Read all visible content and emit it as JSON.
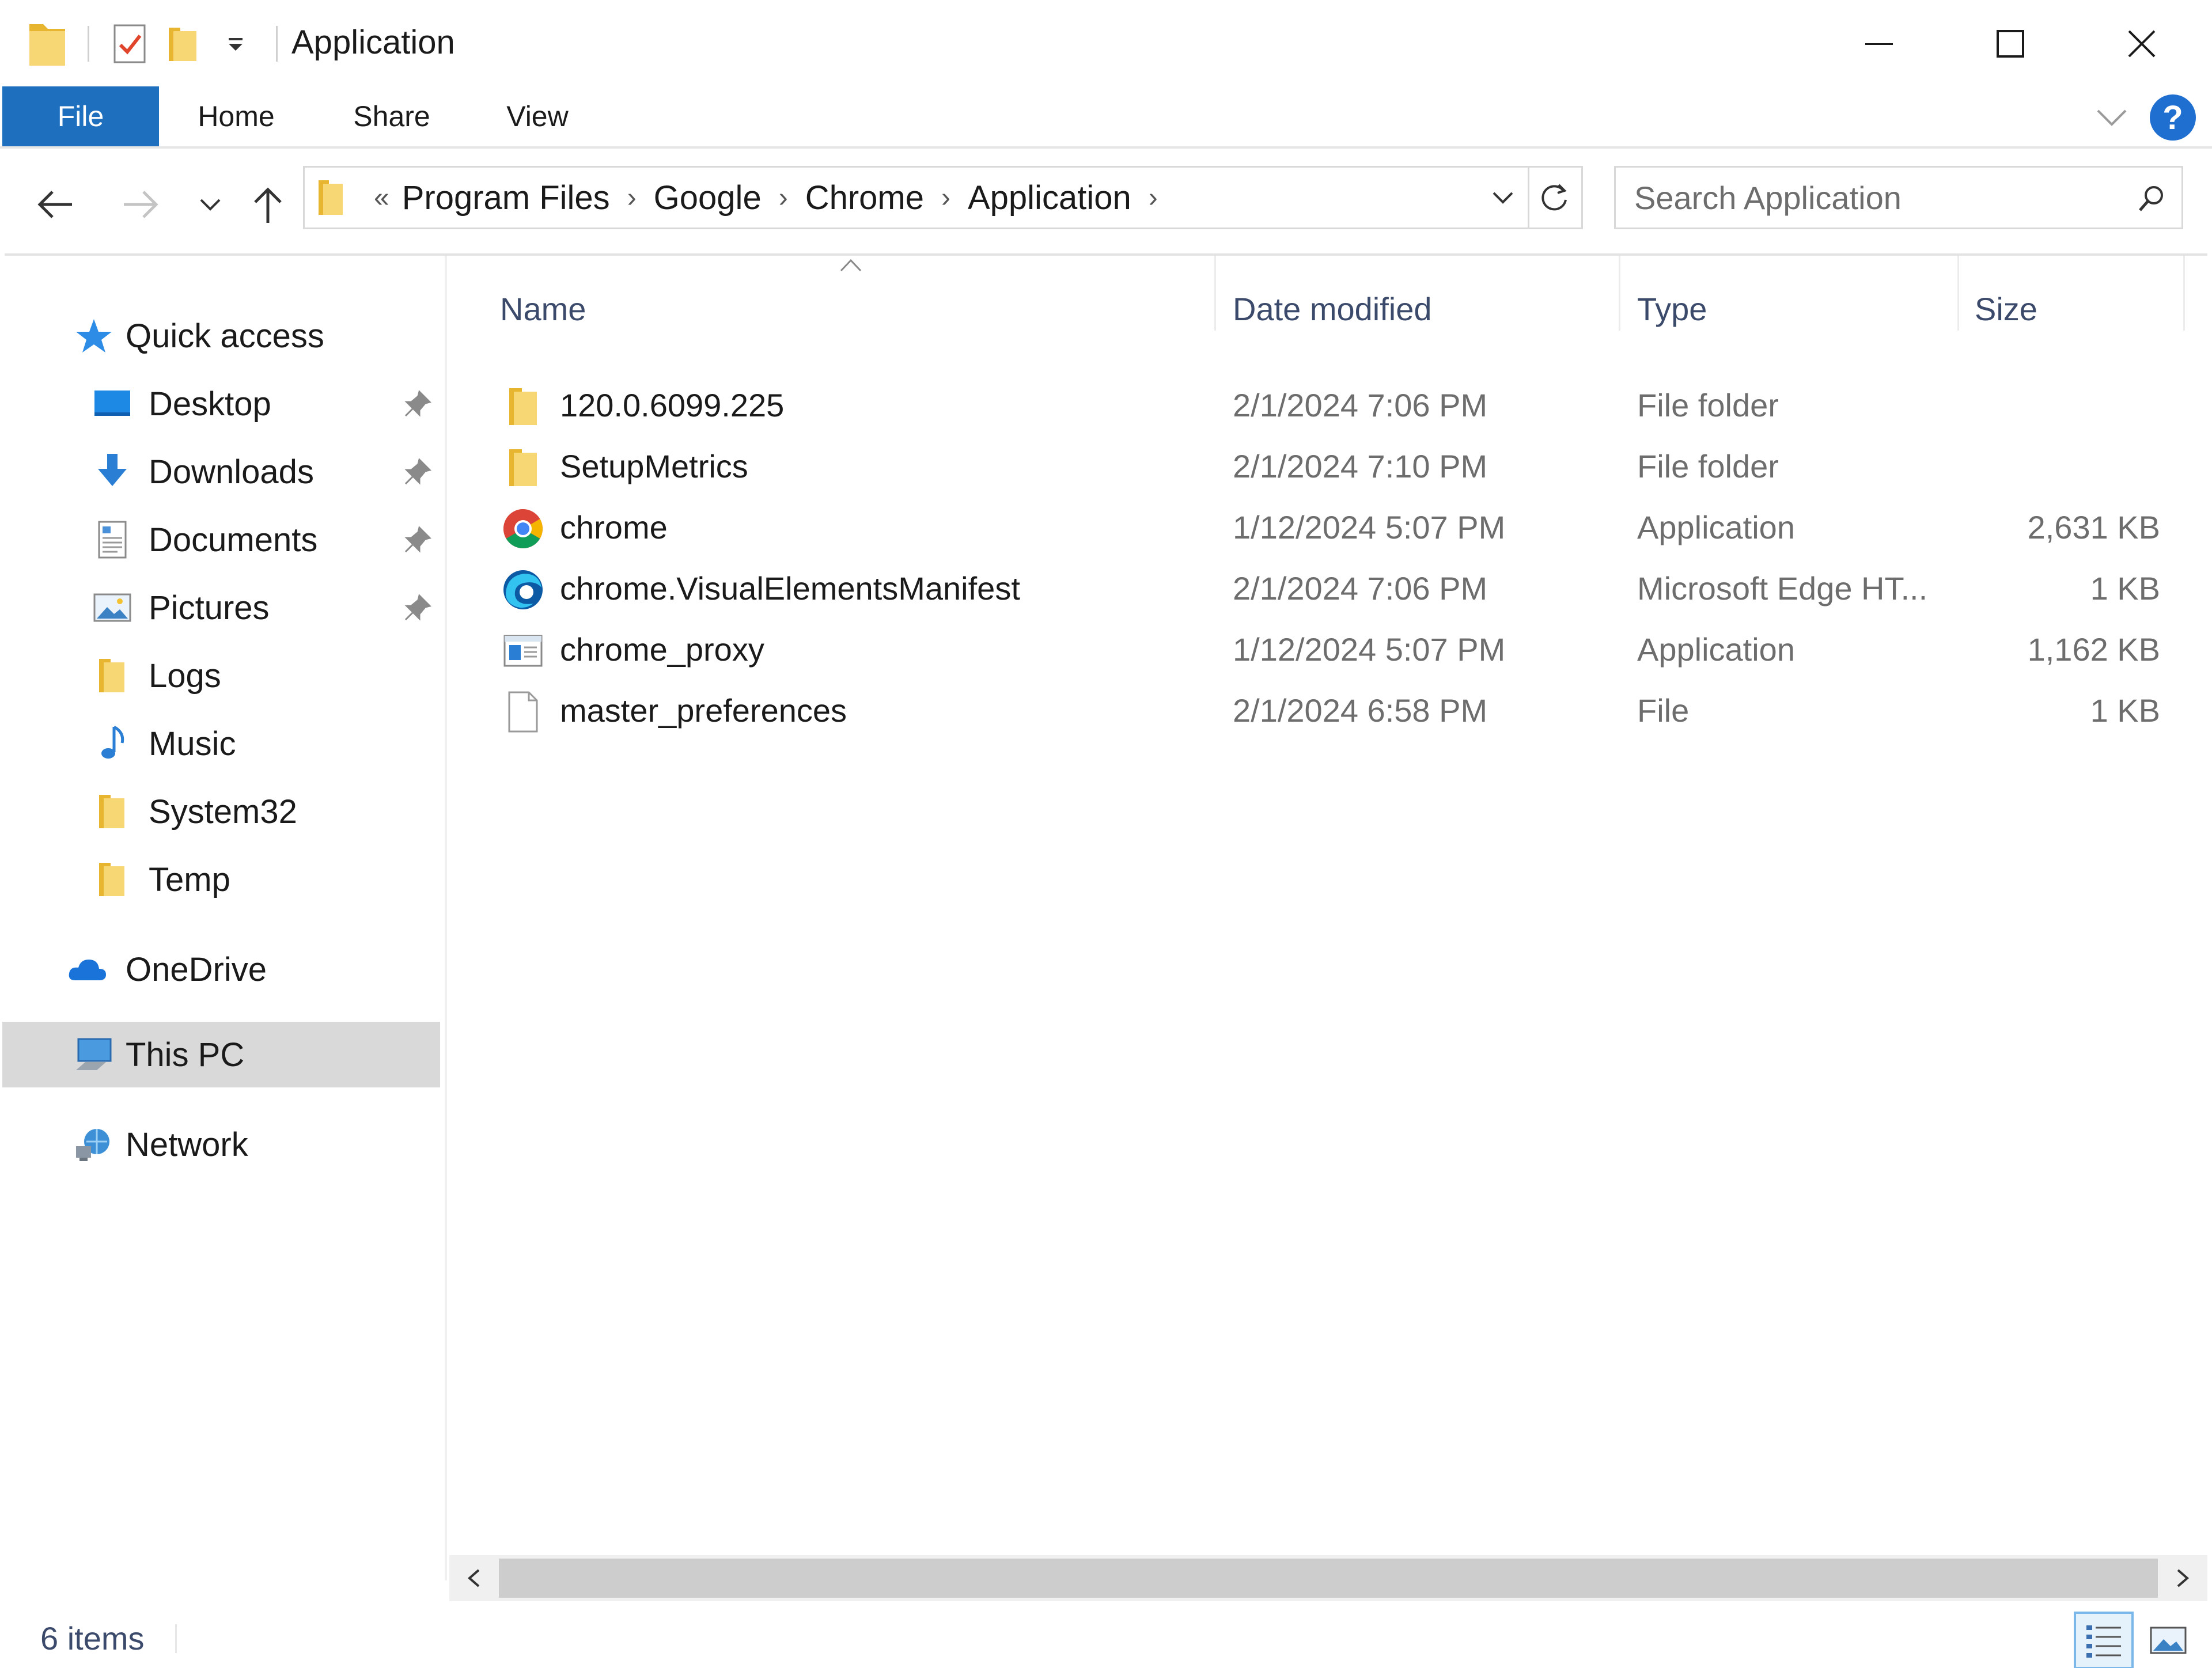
{
  "window": {
    "title": "Application",
    "controls": {
      "minimize": "minimize",
      "maximize": "maximize",
      "close": "close"
    }
  },
  "ribbon": {
    "tabs": [
      "File",
      "Home",
      "Share",
      "View"
    ],
    "help": "?"
  },
  "address_bar": {
    "overflow": "«",
    "breadcrumbs": [
      "Program Files",
      "Google",
      "Chrome",
      "Application"
    ]
  },
  "search": {
    "placeholder": "Search Application"
  },
  "sidebar": {
    "quick_access": "Quick access",
    "items": [
      {
        "label": "Desktop",
        "pinned": true,
        "icon": "desktop-icon"
      },
      {
        "label": "Downloads",
        "pinned": true,
        "icon": "downloads-icon"
      },
      {
        "label": "Documents",
        "pinned": true,
        "icon": "documents-icon"
      },
      {
        "label": "Pictures",
        "pinned": true,
        "icon": "pictures-icon"
      },
      {
        "label": "Logs",
        "pinned": false,
        "icon": "folder-icon"
      },
      {
        "label": "Music",
        "pinned": false,
        "icon": "music-icon"
      },
      {
        "label": "System32",
        "pinned": false,
        "icon": "folder-icon"
      },
      {
        "label": "Temp",
        "pinned": false,
        "icon": "folder-icon"
      }
    ],
    "onedrive": "OneDrive",
    "this_pc": "This PC",
    "network": "Network"
  },
  "columns": {
    "name": "Name",
    "date": "Date modified",
    "type": "Type",
    "size": "Size"
  },
  "files": [
    {
      "name": "120.0.6099.225",
      "date": "2/1/2024 7:06 PM",
      "type": "File folder",
      "size": "",
      "icon": "folder-icon"
    },
    {
      "name": "SetupMetrics",
      "date": "2/1/2024 7:10 PM",
      "type": "File folder",
      "size": "",
      "icon": "folder-icon"
    },
    {
      "name": "chrome",
      "date": "1/12/2024 5:07 PM",
      "type": "Application",
      "size": "2,631 KB",
      "icon": "chrome-icon"
    },
    {
      "name": "chrome.VisualElementsManifest",
      "date": "2/1/2024 7:06 PM",
      "type": "Microsoft Edge HT...",
      "size": "1 KB",
      "icon": "edge-icon"
    },
    {
      "name": "chrome_proxy",
      "date": "1/12/2024 5:07 PM",
      "type": "Application",
      "size": "1,162 KB",
      "icon": "application-icon"
    },
    {
      "name": "master_preferences",
      "date": "2/1/2024 6:58 PM",
      "type": "File",
      "size": "1 KB",
      "icon": "file-icon"
    }
  ],
  "status": {
    "item_count": "6 items"
  },
  "colors": {
    "file_tab": "#1f6fbf",
    "accent": "#1f6fd1",
    "folder": "#f5c542",
    "selected_nav": "#d9d9d9"
  }
}
